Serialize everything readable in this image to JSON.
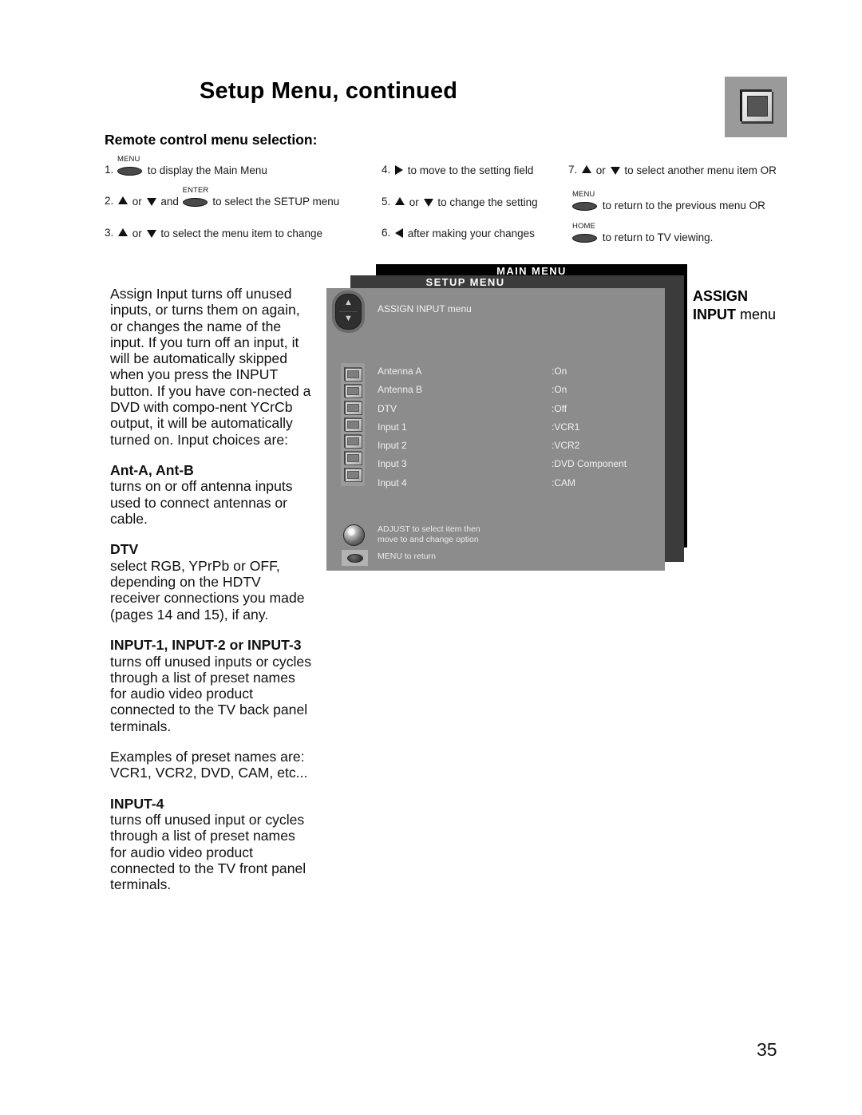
{
  "header": {
    "title": "Setup Menu, continued",
    "badge_icon": "tv-monitor-icon"
  },
  "remote_section": {
    "heading": "Remote control menu selection:",
    "steps": [
      {
        "num": "1.",
        "key": "MENU",
        "pre": "",
        "post": "to display the Main Menu"
      },
      {
        "num": "2.",
        "key": "ENTER",
        "pre": "or",
        "mid": "and",
        "post": "to select the SETUP menu"
      },
      {
        "num": "3.",
        "pre": "or",
        "post": "to select the menu item to change"
      },
      {
        "num": "4.",
        "post": "to move to the setting field"
      },
      {
        "num": "5.",
        "pre": "or",
        "post": "to change the setting"
      },
      {
        "num": "6.",
        "post": "after making your changes"
      },
      {
        "num": "7.",
        "pre": "or",
        "post": "to select another menu item OR"
      },
      {
        "num": "",
        "key": "MENU",
        "post": "to return to the previous menu OR"
      },
      {
        "num": "",
        "key": "HOME",
        "post": "to return to TV viewing."
      }
    ]
  },
  "body": {
    "intro": "Assign Input turns off unused inputs, or turns them on again, or changes the name of the input.  If you turn off an input, it will be automatically skipped when you press the INPUT button.   If you have con-nected a DVD with compo-nent YCrCb output, it will be automatically turned on.  Input choices are:",
    "sections": [
      {
        "heading": "Ant-A, Ant-B",
        "text": "turns on or off antenna inputs used to connect antennas or cable."
      },
      {
        "heading": "DTV",
        "text": "select RGB, YPrPb or OFF, depending on the HDTV receiver connections you made (pages 14 and 15), if any."
      },
      {
        "heading": "INPUT-1, INPUT-2 or INPUT-3",
        "text": "turns off unused inputs or cycles through a list of preset names for audio video product connected to the TV back panel terminals."
      },
      {
        "heading": "",
        "text": "Examples of preset names are: VCR1, VCR2, DVD, CAM, etc..."
      },
      {
        "heading": "INPUT-4",
        "text": "turns off unused input or cycles through a list of preset names for audio video product connected to the TV front panel terminals."
      }
    ]
  },
  "osd": {
    "main_menu_label": "MAIN MENU",
    "setup_menu_label": "SETUP MENU",
    "screen_title": "ASSIGN INPUT menu",
    "rows": [
      {
        "label": "Antenna A",
        "value": ":On"
      },
      {
        "label": "Antenna B",
        "value": ":On"
      },
      {
        "label": "DTV",
        "value": ":Off"
      },
      {
        "label": "Input 1",
        "value": ":VCR1"
      },
      {
        "label": "Input 2",
        "value": ":VCR2"
      },
      {
        "label": "Input 3",
        "value": ":DVD Component"
      },
      {
        "label": "Input 4",
        "value": ":CAM"
      }
    ],
    "hints": [
      {
        "icon": "adjust-knob-icon",
        "line1": "ADJUST to select item then",
        "line2": "move to and change option"
      },
      {
        "icon": "menu-button-icon",
        "line1": "MENU to return",
        "line2": ""
      }
    ],
    "colors": {
      "panel_back": "#000000",
      "panel_mid": "#3b3b3b",
      "panel_front": "#8c8c8c",
      "text": "#f0f0f0"
    }
  },
  "osd_caption": {
    "line1": "ASSIGN",
    "line2_bold": "INPUT",
    "line2_thin": "menu"
  },
  "footer": {
    "page_number": "35"
  }
}
